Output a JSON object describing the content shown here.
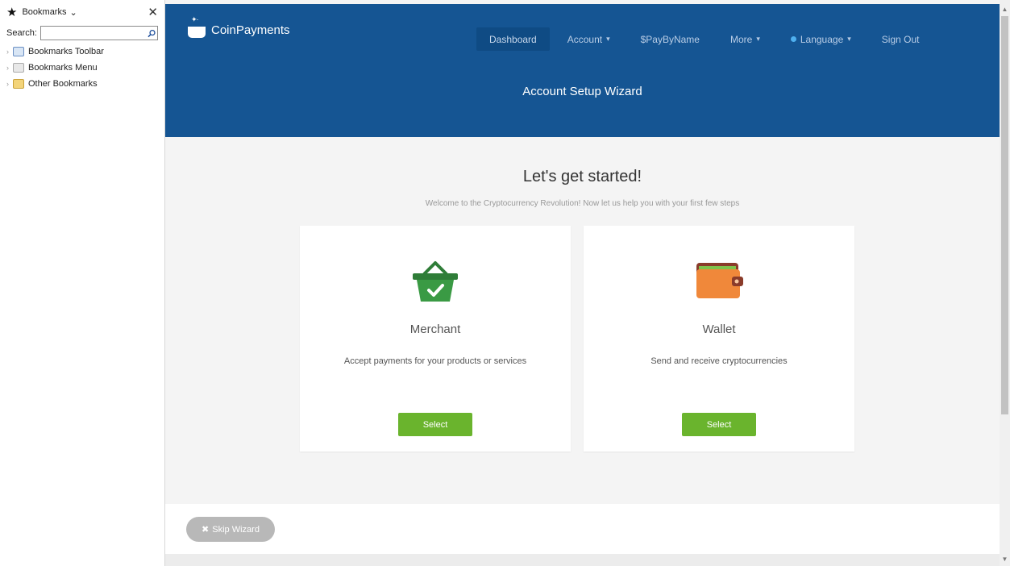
{
  "sidebar": {
    "title": "Bookmarks",
    "search_label": "Search:",
    "search_value": "",
    "items": [
      {
        "label": "Bookmarks Toolbar",
        "icon": "bookmarks-toolbar-icon"
      },
      {
        "label": "Bookmarks Menu",
        "icon": "bookmarks-menu-icon"
      },
      {
        "label": "Other Bookmarks",
        "icon": "folder-icon"
      }
    ]
  },
  "header": {
    "brand": "CoinPayments",
    "nav": [
      {
        "label": "Dashboard",
        "active": true
      },
      {
        "label": "Account",
        "dropdown": true
      },
      {
        "label": "$PayByName"
      },
      {
        "label": "More",
        "dropdown": true
      },
      {
        "label": "Language",
        "dropdown": true,
        "dot_color": "#4fb0ef"
      },
      {
        "label": "Sign Out"
      }
    ],
    "page_title": "Account Setup Wizard"
  },
  "main": {
    "heading": "Let's get started!",
    "subheading": "Welcome to the Cryptocurrency Revolution! Now let us help you with your first few steps",
    "cards": [
      {
        "title": "Merchant",
        "description": "Accept payments for your products or services",
        "button": "Select",
        "icon": "shopping-basket-check-icon"
      },
      {
        "title": "Wallet",
        "description": "Send and receive cryptocurrencies",
        "button": "Select",
        "icon": "wallet-icon"
      }
    ]
  },
  "footer": {
    "skip_label": "Skip Wizard"
  },
  "colors": {
    "brand_blue": "#155593",
    "select_green": "#6ab42d",
    "basket_green": "#3a9a44",
    "wallet_orange": "#f0883a"
  }
}
